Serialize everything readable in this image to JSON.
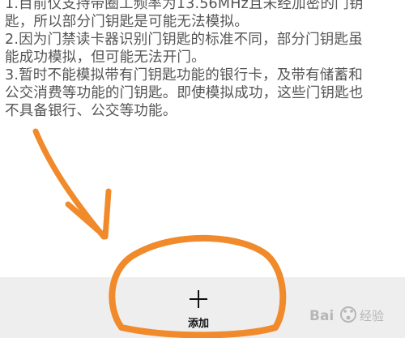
{
  "instructions": {
    "lines": [
      "1.目前仅支持带圈工频率为13.56MHz且未经加密的门钥",
      "匙，所以部分门钥匙是可能无法模拟。",
      "2.因为门禁读卡器识别门钥匙的标准不同，部分门钥匙虽",
      "能成功模拟，但可能无法开门。",
      "3.暂时不能模拟带有门钥匙功能的银行卡，及带有储蓄和",
      "公交消费等功能的门钥匙。即使模拟成功，这些门钥匙也",
      "不具备银行、公交等功能。"
    ]
  },
  "bottom_bar": {
    "add_icon": "plus-icon",
    "add_label": "添加"
  },
  "annotation": {
    "color": "#f08a2b"
  },
  "watermark": {
    "text": "Baidu经验"
  }
}
